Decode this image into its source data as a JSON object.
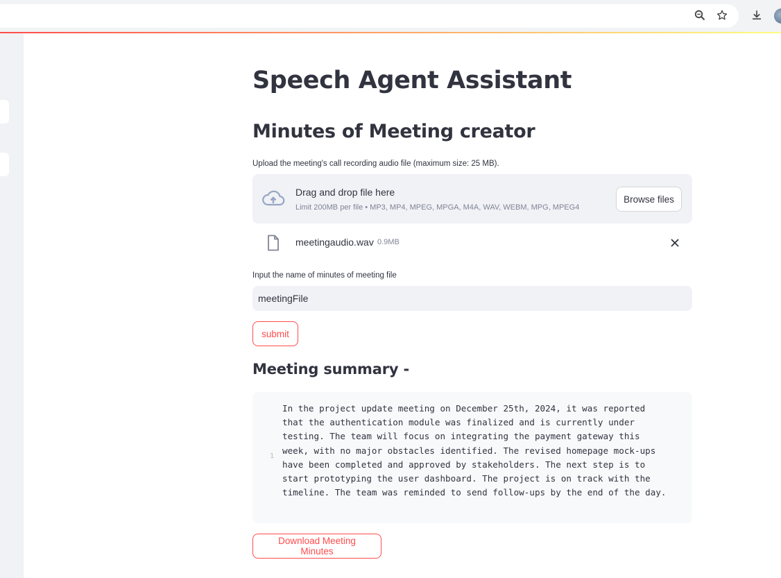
{
  "browser": {
    "icons": [
      "zoom-icon",
      "star-icon",
      "download-icon",
      "profile-avatar"
    ]
  },
  "app": {
    "title": "Speech Agent Assistant",
    "subtitle": "Minutes of Meeting creator",
    "accent_color": "#ff4b4b"
  },
  "uploader": {
    "label": "Upload the meeting's call recording audio file (maximum size: 25 MB).",
    "drop_text": "Drag and drop file here",
    "limit_text": "Limit 200MB per file • MP3, MP4, MPEG, MPGA, M4A, WAV, WEBM, MPG, MPEG4",
    "browse_label": "Browse files",
    "icon": "cloud-upload-icon"
  },
  "uploaded_file": {
    "name": "meetingaudio.wav",
    "size": "0.9MB",
    "icon": "file-icon"
  },
  "name_input": {
    "label": "Input the name of minutes of meeting file",
    "value": "meetingFile"
  },
  "submit_label": "submit",
  "summary": {
    "heading": "Meeting summary -",
    "line_number": "1",
    "text": "In the project update meeting on December 25th, 2024, it was reported that the authentication module was finalized and is currently under testing. The team will focus on integrating the payment gateway this week, with no major obstacles identified. The revised homepage mock-ups have been completed and approved by stakeholders. The next step is to start prototyping the user dashboard. The project is on track with the timeline. The team was reminded to send follow-ups by the end of the day."
  },
  "download_label": "Download Meeting Minutes"
}
